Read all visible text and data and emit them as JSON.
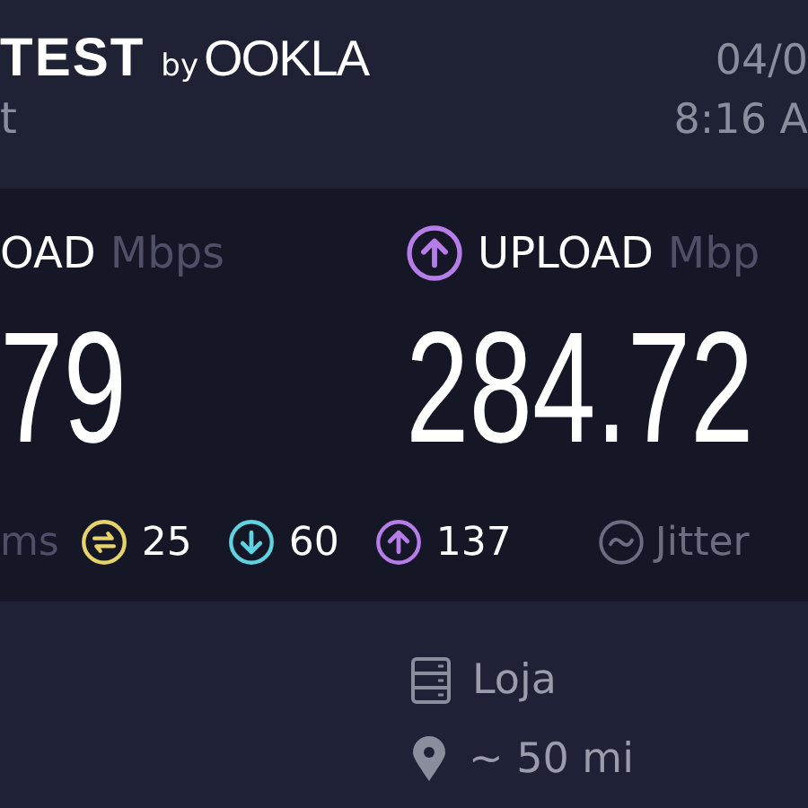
{
  "header": {
    "logo": "TEST",
    "logo_by": "by",
    "logo_brand": "OOKLA",
    "subtitle": "t",
    "date": "04/0",
    "time": "8:16 A"
  },
  "results": [
    {
      "kind": "download",
      "label": "OAD",
      "unit": "Mbps",
      "value": "79"
    },
    {
      "kind": "upload",
      "label": "UPLOAD",
      "unit": "Mbp",
      "value": "284.72"
    }
  ],
  "latency": {
    "unit": "ms",
    "items": [
      {
        "kind": "idle",
        "value": "25"
      },
      {
        "kind": "download",
        "value": "60"
      },
      {
        "kind": "upload",
        "value": "137"
      }
    ],
    "jitter": "Jitter"
  },
  "server": {
    "name": "Loja",
    "distance": "~ 50 mi"
  }
}
